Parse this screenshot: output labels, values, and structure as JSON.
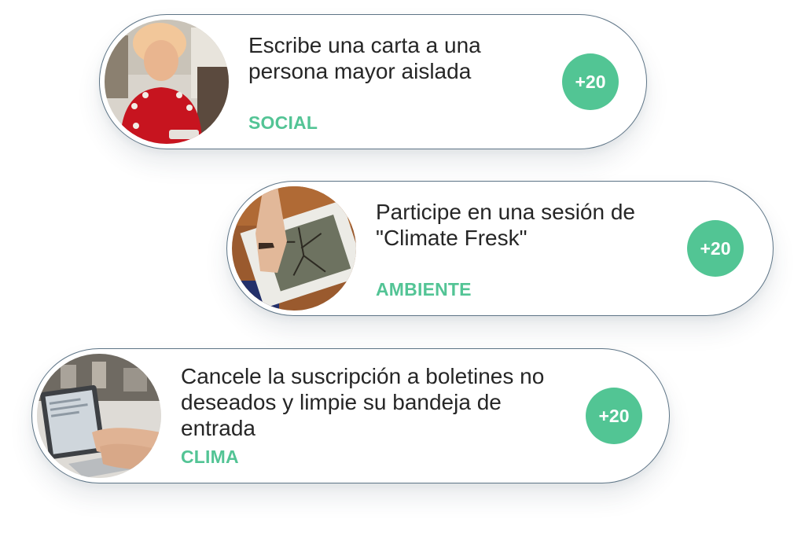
{
  "tasks": [
    {
      "title": "Escribe una carta a una persona mayor aislada",
      "category": "SOCIAL",
      "points": "+20",
      "image": "elderly-woman-photo"
    },
    {
      "title": "Participe en una sesión de \"Climate Fresk\"",
      "category": "AMBIENTE",
      "points": "+20",
      "image": "climate-fresk-card-photo"
    },
    {
      "title": "Cancele la suscripción a boletines no deseados y limpie su bandeja de entrada",
      "category": "CLIMA",
      "points": "+20",
      "image": "laptop-typing-photo"
    }
  ],
  "colors": {
    "accent": "#52c594",
    "category_text": "#53c495",
    "card_border": "#5d7486",
    "title_text": "#262626"
  }
}
